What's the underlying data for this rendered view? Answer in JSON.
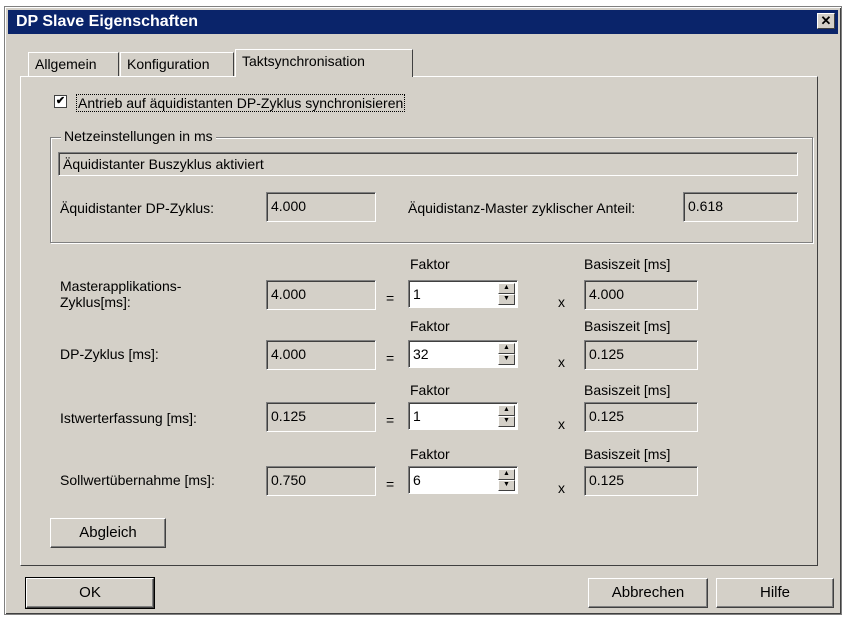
{
  "window": {
    "title": "DP Slave Eigenschaften",
    "close_glyph": "✕"
  },
  "tabs": [
    {
      "label": "Allgemein"
    },
    {
      "label": "Konfiguration"
    },
    {
      "label": "Taktsynchronisation"
    }
  ],
  "sync": {
    "checkbox_label": "Antrieb auf äquidistanten DP-Zyklus synchronisieren",
    "checked": true,
    "check_glyph": "✔"
  },
  "network": {
    "legend": "Netzeinstellungen in ms",
    "status": "Äquidistanter Buszyklus aktiviert",
    "dp_cycle_label": "Äquidistanter DP-Zyklus:",
    "dp_cycle_value": "4.000",
    "master_share_label": "Äquidistanz-Master zyklischer Anteil:",
    "master_share_value": "0.618"
  },
  "rows": [
    {
      "label": "Masterapplikations-\nZyklus[ms]:",
      "value": "4.000",
      "eq": "=",
      "factor_label": "Faktor",
      "factor": "1",
      "x": "x",
      "base_label": "Basiszeit [ms]",
      "base": "4.000"
    },
    {
      "label": "DP-Zyklus [ms]:",
      "value": "4.000",
      "eq": "=",
      "factor_label": "Faktor",
      "factor": "32",
      "x": "x",
      "base_label": "Basiszeit [ms]",
      "base": "0.125"
    },
    {
      "label": "Istwerterfassung [ms]:",
      "value": "0.125",
      "eq": "=",
      "factor_label": "Faktor",
      "factor": "1",
      "x": "x",
      "base_label": "Basiszeit [ms]",
      "base": "0.125"
    },
    {
      "label": "Sollwertübernahme [ms]:",
      "value": "0.750",
      "eq": "=",
      "factor_label": "Faktor",
      "factor": "6",
      "x": "x",
      "base_label": "Basiszeit [ms]",
      "base": "0.125"
    }
  ],
  "buttons": {
    "align": "Abgleich",
    "ok": "OK",
    "cancel": "Abbrechen",
    "help": "Hilfe"
  },
  "spinner_glyphs": {
    "up": "▲",
    "down": "▼"
  }
}
